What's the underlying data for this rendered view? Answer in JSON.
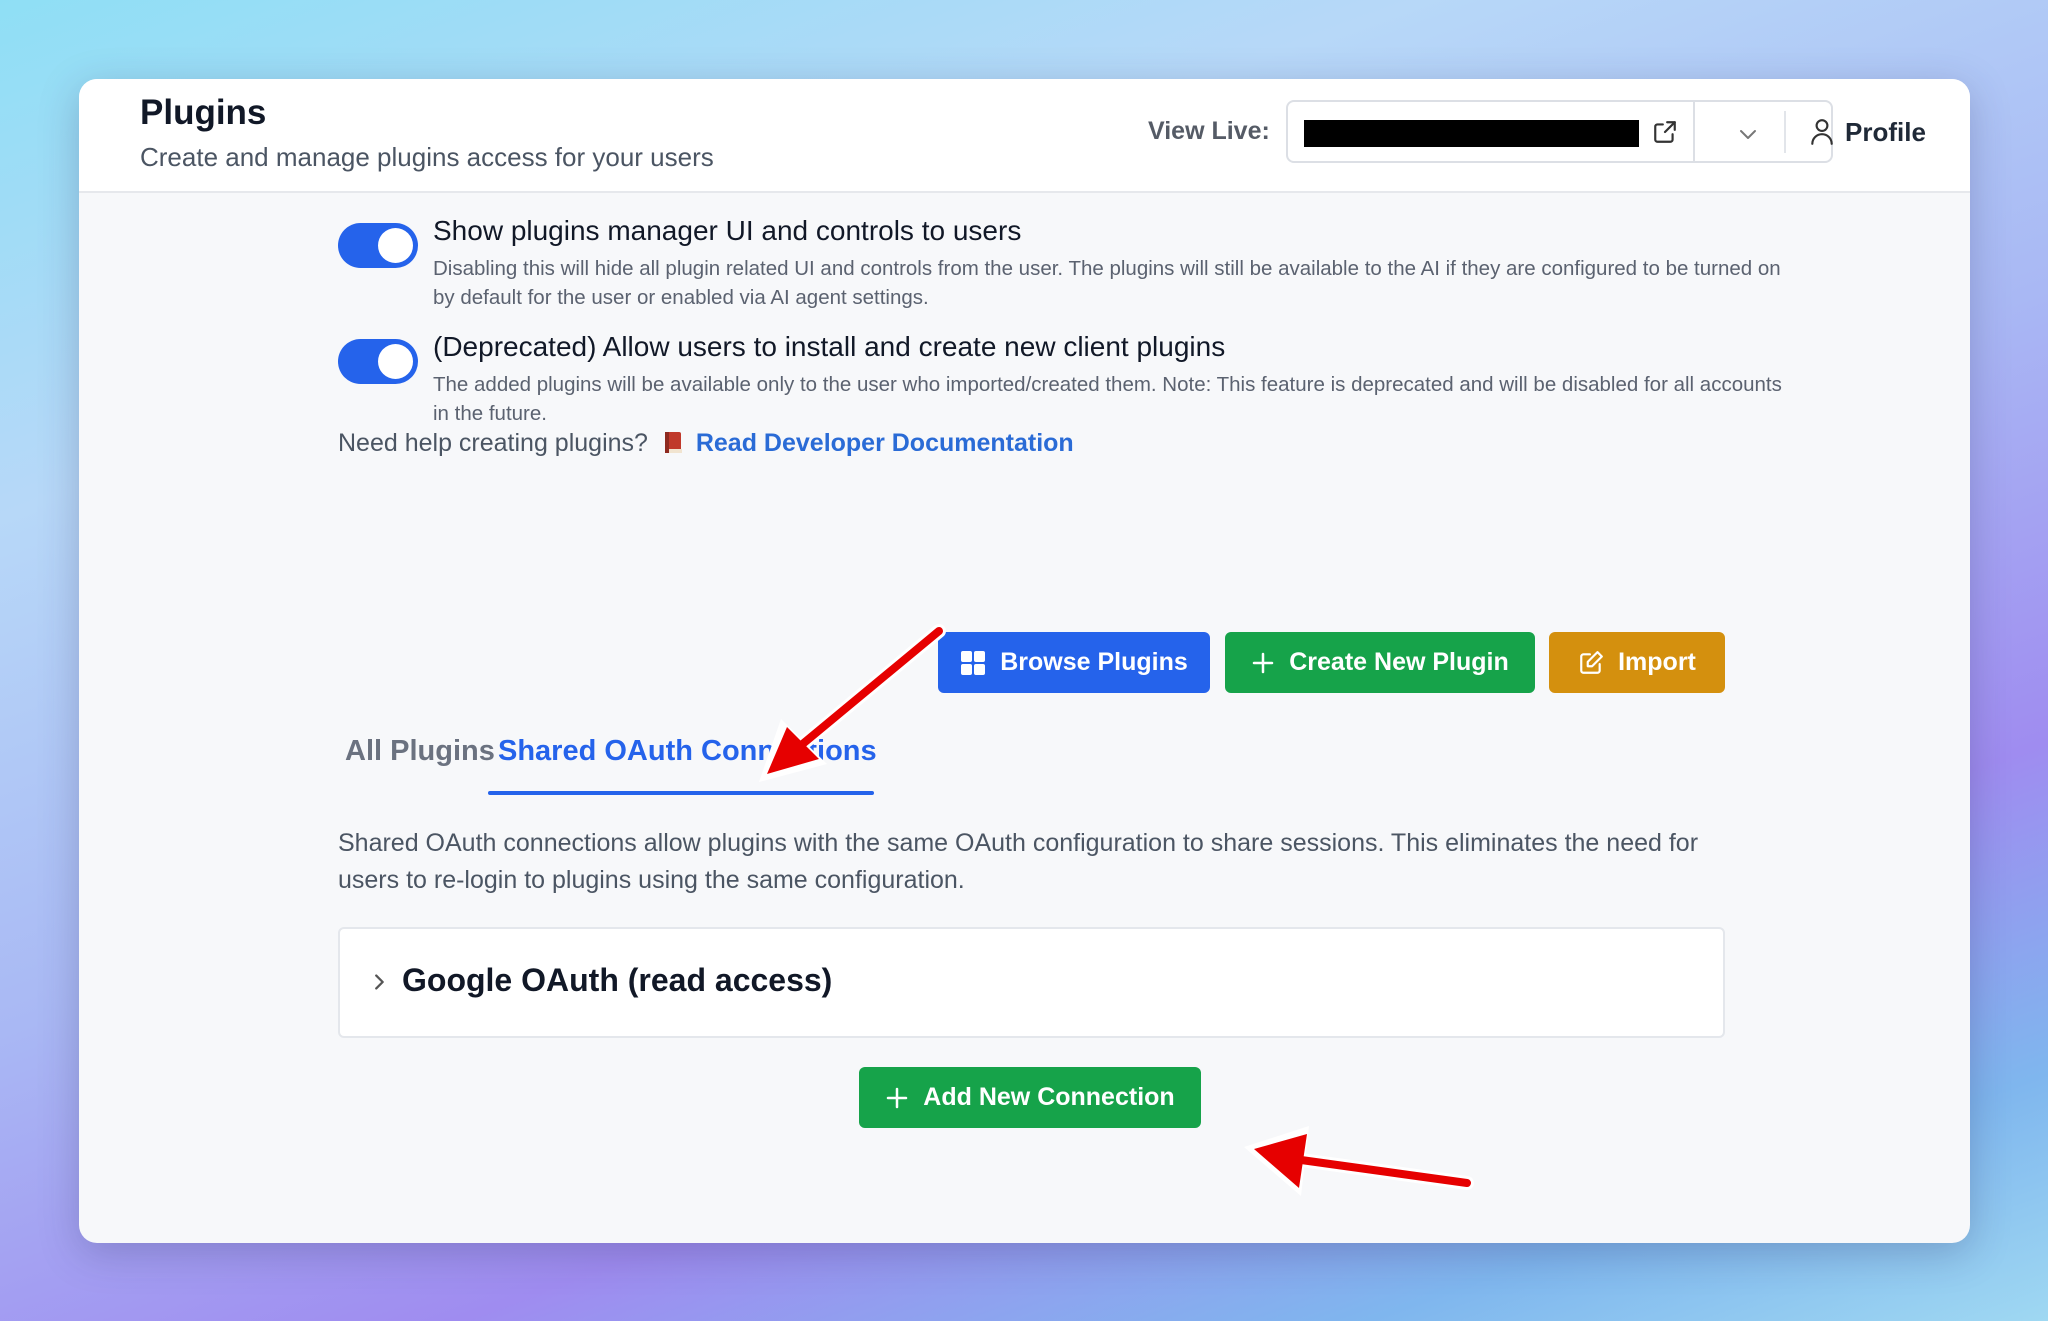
{
  "header": {
    "title": "Plugins",
    "subtitle": "Create and manage plugins access for your users",
    "view_live_label": "View Live:",
    "profile_label": "Profile"
  },
  "settings": [
    {
      "title": "Show plugins manager UI and controls to users",
      "description": "Disabling this will hide all plugin related UI and controls from the user. The plugins will still be available to the AI if they are configured to be turned on by default for the user or enabled via AI agent settings.",
      "enabled": true
    },
    {
      "title": "(Deprecated) Allow users to install and create new client plugins",
      "description": "The added plugins will be available only to the user who imported/created them. Note: This feature is deprecated and will be disabled for all accounts in the future.",
      "enabled": true
    }
  ],
  "help": {
    "text": "Need help creating plugins?",
    "link_label": "Read Developer Documentation"
  },
  "actions": {
    "browse_label": "Browse Plugins",
    "create_label": "Create New Plugin",
    "import_label": "Import"
  },
  "tabs": [
    {
      "label": "All Plugins",
      "active": false
    },
    {
      "label": "Shared OAuth Connections",
      "active": true
    }
  ],
  "shared_oauth": {
    "description": "Shared OAuth connections allow plugins with the same OAuth configuration to share sessions. This eliminates the need for users to re-login to plugins using the same configuration.",
    "connections": [
      {
        "name": "Google OAuth (read access)"
      }
    ],
    "add_label": "Add New Connection"
  },
  "colors": {
    "primary_blue": "#2563eb",
    "success_green": "#16a34a",
    "import_orange": "#d4900e",
    "annotation_red": "#e60000"
  },
  "icons": [
    "external-link-icon",
    "chevron-down-icon",
    "user-icon",
    "book-icon",
    "grid-icon",
    "plus-icon",
    "edit-icon",
    "chevron-right-icon"
  ]
}
